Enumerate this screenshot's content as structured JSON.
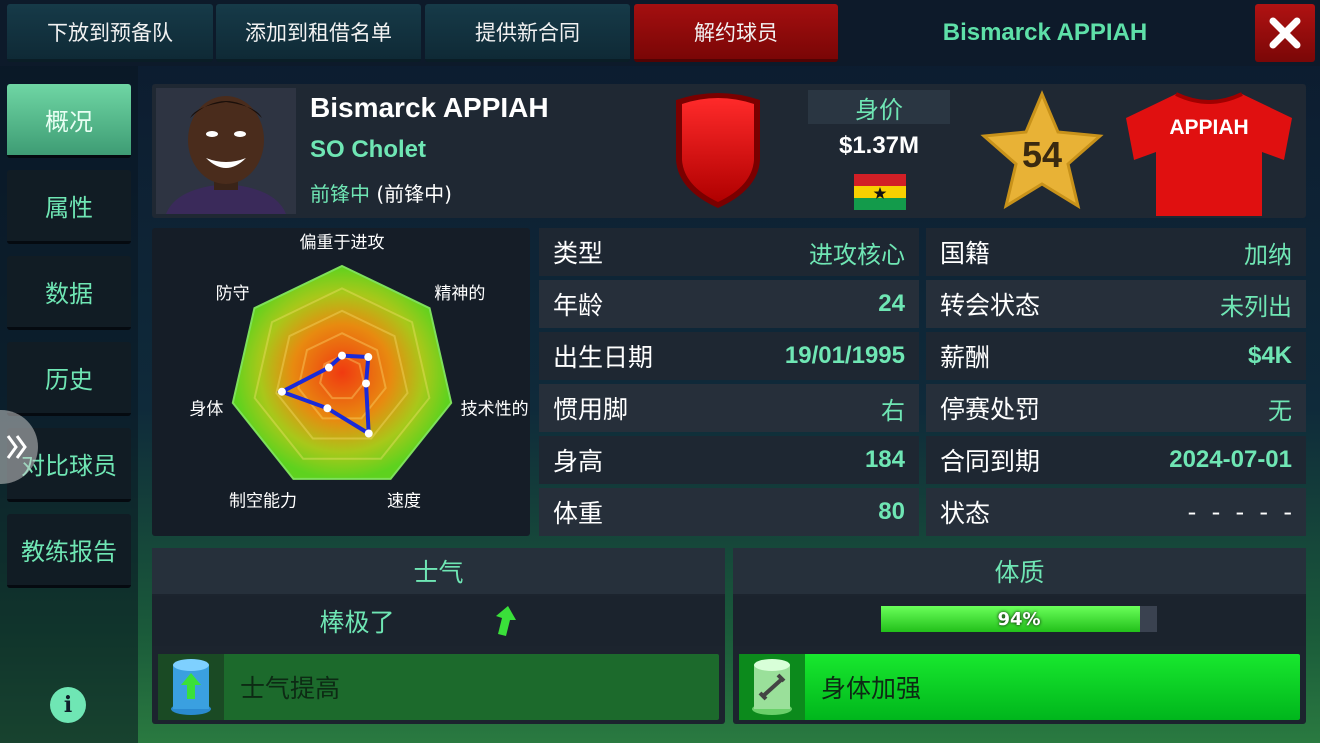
{
  "top_bar": {
    "buttons": [
      {
        "label": "下放到预备队"
      },
      {
        "label": "添加到租借名单"
      },
      {
        "label": "提供新合同"
      },
      {
        "label": "解约球员"
      }
    ],
    "title": "Bismarck APPIAH"
  },
  "sidebar": {
    "items": [
      {
        "label": "概况",
        "active": true
      },
      {
        "label": "属性"
      },
      {
        "label": "数据"
      },
      {
        "label": "历史"
      },
      {
        "label": "对比球员"
      },
      {
        "label": "教练报告"
      }
    ]
  },
  "player": {
    "name": "Bismarck APPIAH",
    "club": "SO Cholet",
    "position_main": "前锋中",
    "position_alt": "(前锋中)",
    "value_label": "身价",
    "value": "$1.37M",
    "nationality_flag": "ghana-flag",
    "rating": "54",
    "shirt_name": "APPIAH",
    "club_color": "#e01010"
  },
  "radar": {
    "axes": [
      "偏重于进攻",
      "精神的",
      "技术性的",
      "速度",
      "制空能力",
      "身体",
      "防守"
    ],
    "values": [
      0.2,
      0.3,
      0.22,
      0.55,
      0.3,
      0.55,
      0.15
    ]
  },
  "stats_left": [
    {
      "label": "类型",
      "value": "进攻核心"
    },
    {
      "label": "年龄",
      "value": "24"
    },
    {
      "label": "出生日期",
      "value": "19/01/1995"
    },
    {
      "label": "惯用脚",
      "value": "右"
    },
    {
      "label": "身高",
      "value": "184"
    },
    {
      "label": "体重",
      "value": "80"
    }
  ],
  "stats_right": [
    {
      "label": "国籍",
      "value": "加纳"
    },
    {
      "label": "转会状态",
      "value": "未列出"
    },
    {
      "label": "薪酬",
      "value": "$4K"
    },
    {
      "label": "停赛处罚",
      "value": "无"
    },
    {
      "label": "合同到期",
      "value": "2024-07-01"
    },
    {
      "label": "状态",
      "value": "-  -  -  -  -"
    }
  ],
  "morale": {
    "title": "士气",
    "status": "棒极了",
    "action_label": "士气提高"
  },
  "fitness": {
    "title": "体质",
    "percent_label": "94%",
    "percent": 0.94,
    "action_label": "身体加强"
  },
  "colors": {
    "accent": "#6fe6b4",
    "danger": "#a40f10",
    "bright_green": "#00d624"
  }
}
